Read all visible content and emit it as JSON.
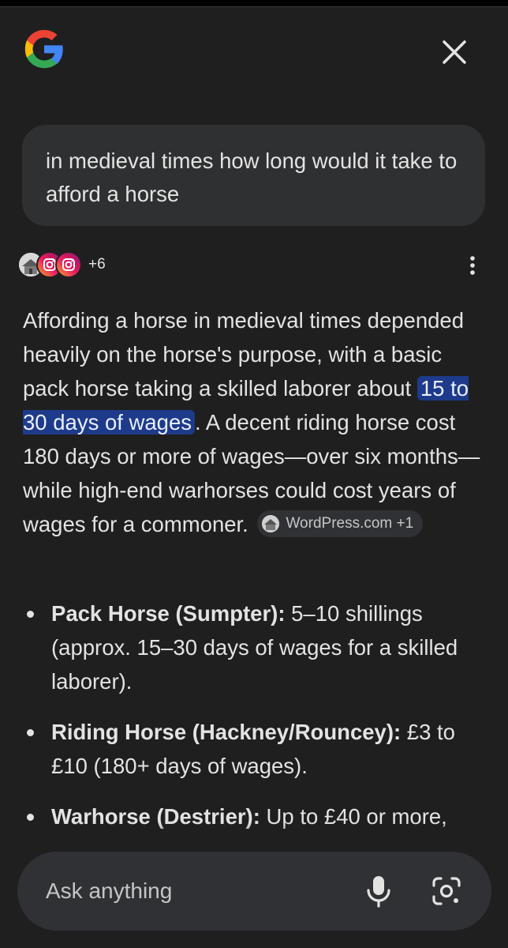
{
  "header": {
    "logo_icon": "google-g-logo",
    "close_icon": "close-icon"
  },
  "query": {
    "text": "in medieval times how long would it take to afford a horse"
  },
  "sources": {
    "count_label": "+6",
    "icons": [
      "website-thumbnail",
      "instagram-icon",
      "instagram-icon"
    ],
    "more_icon": "more-vert-icon"
  },
  "answer": {
    "part1": "Affording a horse in medieval times depended heavily on the horse's purpose, with a basic pack horse taking a skilled laborer about ",
    "highlight": "15 to 30 days of wages",
    "part2": ". A decent riding horse cost 180 days or more of wages—over six months—while high-end warhorses could cost years of wages for a commoner. ",
    "chip_label": "WordPress.com +1"
  },
  "bullets": [
    {
      "title": "Pack Horse (Sumpter):",
      "text": " 5–10 shillings (approx. 15–30 days of wages for a skilled laborer)."
    },
    {
      "title": "Riding Horse (Hackney/Rouncey):",
      "text": " £3 to £10 (180+ days of wages)."
    },
    {
      "title": "Warhorse (Destrier):",
      "text": " Up to £40 or more,"
    }
  ],
  "ask_bar": {
    "placeholder": "Ask anything",
    "mic_icon": "microphone-icon",
    "lens_icon": "google-lens-icon"
  },
  "colors": {
    "background": "#1f1f1f",
    "bubble": "#2f3032",
    "highlight": "#1e3a8a",
    "text": "#e3e3e3"
  }
}
